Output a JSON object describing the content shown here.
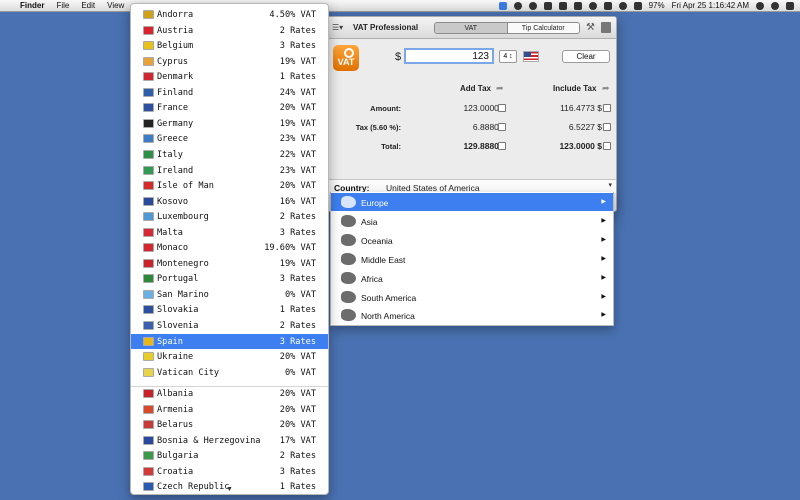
{
  "menubar": {
    "apple": "",
    "app_name": "Finder",
    "menus": [
      "File",
      "Edit",
      "View"
    ],
    "battery": "97%",
    "clock": "Fri Apr 25  1:16:42 AM"
  },
  "vat_window": {
    "title": "VAT Professional",
    "tabs": [
      "VAT",
      "Tip Calculator"
    ],
    "selected_tab": "VAT",
    "currency_symbol": "$",
    "amount": "123",
    "decimals": "4 ↕",
    "clear_label": "Clear",
    "logo_text": "VAT",
    "col_add": "Add Tax",
    "col_include": "Include Tax",
    "rows": [
      {
        "label": "Amount:",
        "add": "123.0000 $",
        "include": "116.4773 $"
      },
      {
        "label": "Tax (5.60 %):",
        "add": "6.8880 $",
        "include": "6.5227 $"
      },
      {
        "label": "Total:",
        "add": "129.8880 $",
        "include": "123.0000 $"
      }
    ],
    "country_label": "Country:",
    "country_value": "United States of America",
    "country_arrow": "▾"
  },
  "regions": [
    {
      "label": "Europe",
      "highlighted": true
    },
    {
      "label": "Asia",
      "highlighted": false
    },
    {
      "label": "Oceania",
      "highlighted": false
    },
    {
      "label": "Middle East",
      "highlighted": false
    },
    {
      "label": "Africa",
      "highlighted": false
    },
    {
      "label": "South America",
      "highlighted": false
    },
    {
      "label": "North America",
      "highlighted": false
    }
  ],
  "region_arrow": "▶",
  "countries_group1": [
    {
      "name": "Andorra",
      "rate": "4.50% VAT",
      "flag": "#d0a21a"
    },
    {
      "name": "Austria",
      "rate": "2 Rates",
      "flag": "#d9232e"
    },
    {
      "name": "Belgium",
      "rate": "3 Rates",
      "flag": "#e8c21a"
    },
    {
      "name": "Cyprus",
      "rate": "19% VAT",
      "flag": "#e8a23a"
    },
    {
      "name": "Denmark",
      "rate": "1 Rates",
      "flag": "#cf2631"
    },
    {
      "name": "Finland",
      "rate": "24% VAT",
      "flag": "#2f5fa8"
    },
    {
      "name": "France",
      "rate": "20% VAT",
      "flag": "#2f4f9f"
    },
    {
      "name": "Germany",
      "rate": "19% VAT",
      "flag": "#222222"
    },
    {
      "name": "Greece",
      "rate": "23% VAT",
      "flag": "#3e7cc7"
    },
    {
      "name": "Italy",
      "rate": "22% VAT",
      "flag": "#2c8f46"
    },
    {
      "name": "Ireland",
      "rate": "23% VAT",
      "flag": "#2e9a52"
    },
    {
      "name": "Isle of Man",
      "rate": "20% VAT",
      "flag": "#d42a2a"
    },
    {
      "name": "Kosovo",
      "rate": "16% VAT",
      "flag": "#2a4a9a"
    },
    {
      "name": "Luxembourg",
      "rate": "2 Rates",
      "flag": "#4f9ad6"
    },
    {
      "name": "Malta",
      "rate": "3 Rates",
      "flag": "#d42a35"
    },
    {
      "name": "Monaco",
      "rate": "19.60% VAT",
      "flag": "#d4262f"
    },
    {
      "name": "Montenegro",
      "rate": "19% VAT",
      "flag": "#c8222a"
    },
    {
      "name": "Portugal",
      "rate": "3 Rates",
      "flag": "#2a8a3a"
    },
    {
      "name": "San Marino",
      "rate": "0% VAT",
      "flag": "#6ab0e0"
    },
    {
      "name": "Slovakia",
      "rate": "1 Rates",
      "flag": "#2b4fa0"
    },
    {
      "name": "Slovenia",
      "rate": "2 Rates",
      "flag": "#3a5fb0"
    },
    {
      "name": "Spain",
      "rate": "3 Rates",
      "flag": "#e8b81a",
      "highlighted": true
    },
    {
      "name": "Ukraine",
      "rate": "20% VAT",
      "flag": "#e8cc2a"
    },
    {
      "name": "Vatican City",
      "rate": "0% VAT",
      "flag": "#e8d44a"
    }
  ],
  "countries_group2": [
    {
      "name": "Albania",
      "rate": "20% VAT",
      "flag": "#c8222a"
    },
    {
      "name": "Armenia",
      "rate": "20% VAT",
      "flag": "#d84a2a"
    },
    {
      "name": "Belarus",
      "rate": "20% VAT",
      "flag": "#c83a3a"
    },
    {
      "name": "Bosnia & Herzegovina",
      "rate": "17% VAT",
      "flag": "#2a4aa0"
    },
    {
      "name": "Bulgaria",
      "rate": "2 Rates",
      "flag": "#3a9a4a"
    },
    {
      "name": "Croatia",
      "rate": "3 Rates",
      "flag": "#d43a3a"
    },
    {
      "name": "Czech Republic",
      "rate": "1 Rates",
      "flag": "#2a5ab0"
    }
  ],
  "scroll_arrow": "▼"
}
